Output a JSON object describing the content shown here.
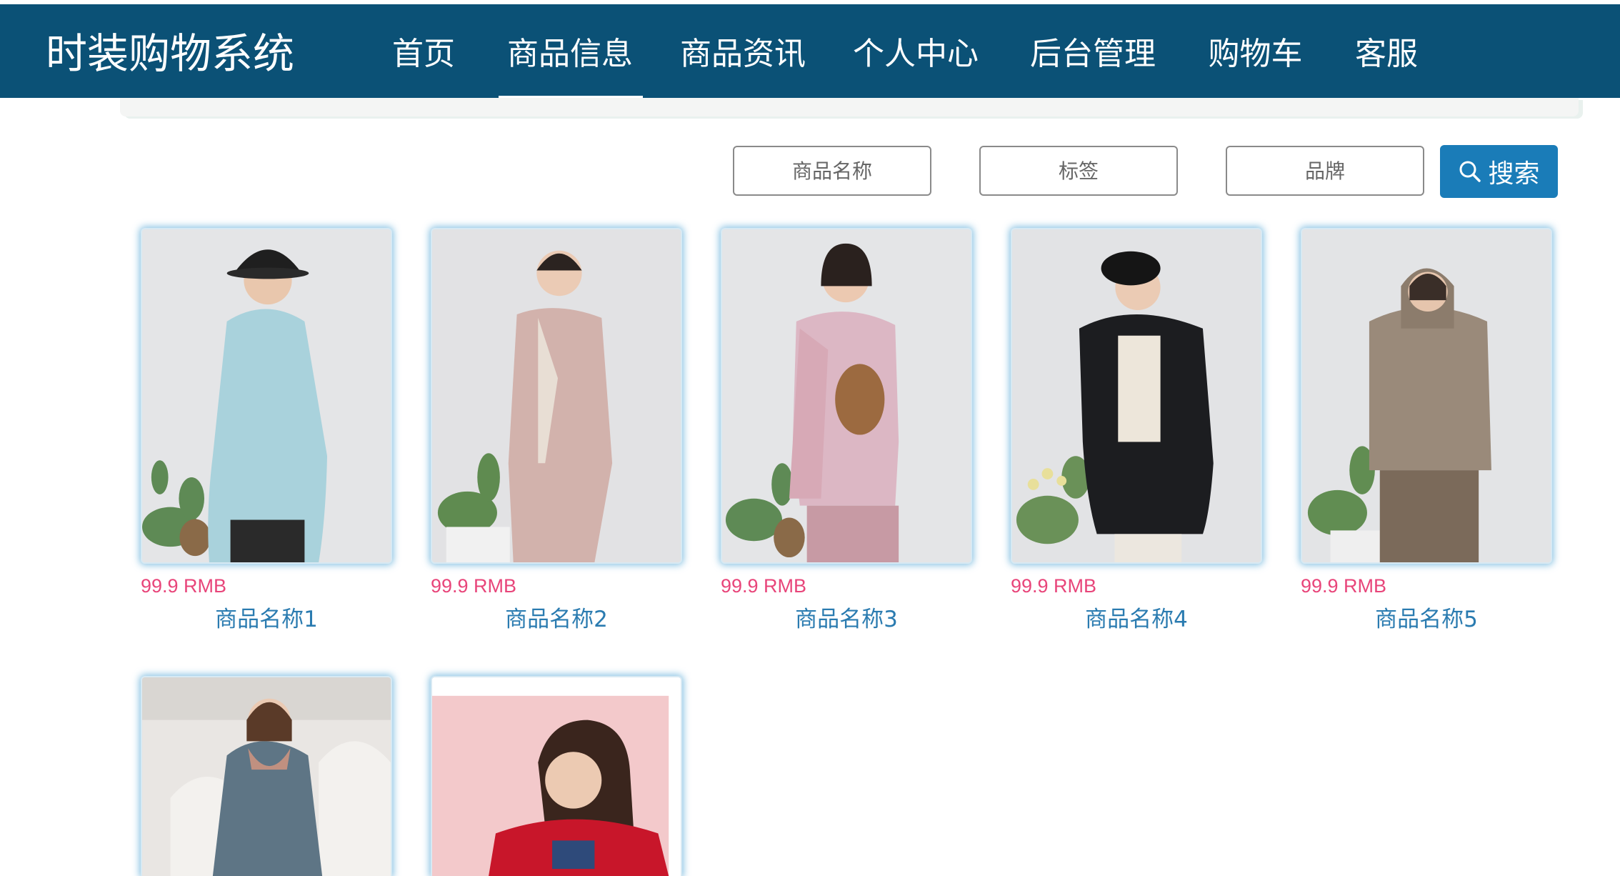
{
  "header": {
    "brand": "时装购物系统",
    "nav": [
      {
        "label": "首页",
        "active": false
      },
      {
        "label": "商品信息",
        "active": true
      },
      {
        "label": "商品资讯",
        "active": false
      },
      {
        "label": "个人中心",
        "active": false
      },
      {
        "label": "后台管理",
        "active": false
      },
      {
        "label": "购物车",
        "active": false
      },
      {
        "label": "客服",
        "active": false
      }
    ]
  },
  "search": {
    "name_placeholder": "商品名称",
    "tag_placeholder": "标签",
    "brand_placeholder": "品牌",
    "button_label": "搜索",
    "button_icon": "search-icon"
  },
  "products": [
    {
      "price": "99.9 RMB",
      "name": "商品名称1",
      "image": "woman in light blue hoodie and black bucket hat"
    },
    {
      "price": "99.9 RMB",
      "name": "商品名称2",
      "image": "woman in dusty pink blazer suit"
    },
    {
      "price": "99.9 RMB",
      "name": "商品名称3",
      "image": "woman in pink sweatshirt with tweed sleeves"
    },
    {
      "price": "99.9 RMB",
      "name": "商品名称4",
      "image": "woman in black puffer coat and beret"
    },
    {
      "price": "99.9 RMB",
      "name": "商品名称5",
      "image": "woman in taupe knit hoodie"
    },
    {
      "image": "woman in grey-blue trench coat with scarf"
    },
    {
      "image": "woman in red top against pink background"
    }
  ],
  "colors": {
    "header_bg": "#0b5176",
    "search_button": "#1a7cb8",
    "price": "#e8457a",
    "product_name": "#2a7bb0",
    "card_glow": "#46a0d2"
  }
}
